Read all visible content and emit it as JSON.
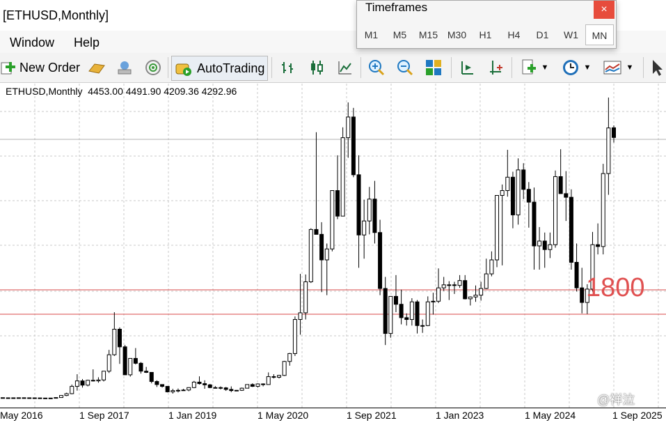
{
  "window": {
    "title": "[ETHUSD,Monthly]"
  },
  "menu": {
    "items": [
      "Window",
      "Help"
    ]
  },
  "toolbar": {
    "new_order": "New Order",
    "autotrading": "AutoTrading"
  },
  "timeframes_popup": {
    "title": "Timeframes",
    "close": "×",
    "items": [
      "M1",
      "M5",
      "M15",
      "M30",
      "H1",
      "H4",
      "D1",
      "W1",
      "MN"
    ],
    "active": "MN"
  },
  "chart": {
    "symbol": "ETHUSD,Monthly",
    "ohlc": "4453.00 4491.90 4209.36 4292.96",
    "level_label": "1800",
    "x_ticks": [
      "May 2016",
      "1 Sep 2017",
      "1 Jan 2019",
      "1 May 2020",
      "1 Sep 2021",
      "1 Jan 2023",
      "1 May 2024",
      "1 Sep 2025"
    ],
    "level_color": "#d94a4a",
    "up_color": "#ffffff",
    "down_color": "#000000"
  },
  "watermark": "@祥泣",
  "chart_data": {
    "type": "candlestick",
    "x_ticks": [
      "May 2016",
      "1 Sep 2017",
      "1 Jan 2019",
      "1 May 2020",
      "1 Sep 2021",
      "1 Jan 2023",
      "1 May 2024",
      "1 Sep 2025"
    ],
    "horizontal_levels": [
      1800
    ],
    "last_ohlc": {
      "open": 4453.0,
      "high": 4491.9,
      "low": 4209.36,
      "close": 4292.96
    },
    "candles": [
      {
        "o": 14,
        "h": 14,
        "l": 12,
        "c": 12
      },
      {
        "o": 12,
        "h": 13,
        "l": 11,
        "c": 11
      },
      {
        "o": 11,
        "h": 12,
        "l": 10,
        "c": 12
      },
      {
        "o": 12,
        "h": 13,
        "l": 11,
        "c": 13
      },
      {
        "o": 13,
        "h": 14,
        "l": 12,
        "c": 12
      },
      {
        "o": 12,
        "h": 13,
        "l": 10,
        "c": 11
      },
      {
        "o": 11,
        "h": 12,
        "l": 9,
        "c": 10
      },
      {
        "o": 10,
        "h": 10,
        "l": 7,
        "c": 8
      },
      {
        "o": 8,
        "h": 10,
        "l": 7,
        "c": 8
      },
      {
        "o": 8,
        "h": 9,
        "l": 8,
        "c": 8
      },
      {
        "o": 8,
        "h": 17,
        "l": 8,
        "c": 16
      },
      {
        "o": 16,
        "h": 55,
        "l": 15,
        "c": 50
      },
      {
        "o": 50,
        "h": 95,
        "l": 40,
        "c": 80
      },
      {
        "o": 80,
        "h": 230,
        "l": 70,
        "c": 200
      },
      {
        "o": 200,
        "h": 400,
        "l": 130,
        "c": 290
      },
      {
        "o": 290,
        "h": 320,
        "l": 180,
        "c": 220
      },
      {
        "o": 220,
        "h": 310,
        "l": 200,
        "c": 300
      },
      {
        "o": 300,
        "h": 480,
        "l": 280,
        "c": 290
      },
      {
        "o": 290,
        "h": 350,
        "l": 260,
        "c": 305
      },
      {
        "o": 305,
        "h": 340,
        "l": 280,
        "c": 450
      },
      {
        "o": 450,
        "h": 800,
        "l": 420,
        "c": 720
      },
      {
        "o": 720,
        "h": 1420,
        "l": 700,
        "c": 1140
      },
      {
        "o": 1140,
        "h": 1170,
        "l": 570,
        "c": 850
      },
      {
        "o": 850,
        "h": 880,
        "l": 400,
        "c": 390
      },
      {
        "o": 390,
        "h": 420,
        "l": 360,
        "c": 660
      },
      {
        "o": 660,
        "h": 830,
        "l": 560,
        "c": 580
      },
      {
        "o": 580,
        "h": 600,
        "l": 410,
        "c": 450
      },
      {
        "o": 450,
        "h": 520,
        "l": 420,
        "c": 430
      },
      {
        "o": 430,
        "h": 430,
        "l": 250,
        "c": 280
      },
      {
        "o": 280,
        "h": 300,
        "l": 190,
        "c": 230
      },
      {
        "o": 230,
        "h": 230,
        "l": 180,
        "c": 200
      },
      {
        "o": 200,
        "h": 200,
        "l": 100,
        "c": 110
      },
      {
        "o": 110,
        "h": 160,
        "l": 80,
        "c": 130
      },
      {
        "o": 130,
        "h": 165,
        "l": 100,
        "c": 135
      },
      {
        "o": 135,
        "h": 160,
        "l": 130,
        "c": 140
      },
      {
        "o": 140,
        "h": 185,
        "l": 120,
        "c": 180
      },
      {
        "o": 180,
        "h": 290,
        "l": 170,
        "c": 270
      },
      {
        "o": 270,
        "h": 365,
        "l": 230,
        "c": 245
      },
      {
        "o": 245,
        "h": 300,
        "l": 160,
        "c": 225
      },
      {
        "o": 225,
        "h": 240,
        "l": 170,
        "c": 180
      },
      {
        "o": 180,
        "h": 205,
        "l": 165,
        "c": 180
      },
      {
        "o": 180,
        "h": 200,
        "l": 150,
        "c": 175
      },
      {
        "o": 175,
        "h": 190,
        "l": 125,
        "c": 150
      },
      {
        "o": 150,
        "h": 200,
        "l": 105,
        "c": 130
      },
      {
        "o": 130,
        "h": 140,
        "l": 120,
        "c": 135
      },
      {
        "o": 135,
        "h": 180,
        "l": 125,
        "c": 170
      },
      {
        "o": 170,
        "h": 230,
        "l": 175,
        "c": 230
      },
      {
        "o": 230,
        "h": 250,
        "l": 190,
        "c": 200
      },
      {
        "o": 200,
        "h": 250,
        "l": 180,
        "c": 240
      },
      {
        "o": 240,
        "h": 250,
        "l": 200,
        "c": 230
      },
      {
        "o": 230,
        "h": 430,
        "l": 230,
        "c": 360
      },
      {
        "o": 360,
        "h": 400,
        "l": 330,
        "c": 350
      },
      {
        "o": 350,
        "h": 390,
        "l": 330,
        "c": 380
      },
      {
        "o": 380,
        "h": 620,
        "l": 370,
        "c": 610
      },
      {
        "o": 610,
        "h": 750,
        "l": 540,
        "c": 740
      },
      {
        "o": 740,
        "h": 1350,
        "l": 700,
        "c": 1300
      },
      {
        "o": 1300,
        "h": 2050,
        "l": 1050,
        "c": 1410
      },
      {
        "o": 1410,
        "h": 2040,
        "l": 1300,
        "c": 1920
      },
      {
        "o": 1920,
        "h": 2800,
        "l": 1900,
        "c": 2780
      },
      {
        "o": 2780,
        "h": 4380,
        "l": 2700,
        "c": 2700
      },
      {
        "o": 2700,
        "h": 2900,
        "l": 1750,
        "c": 2280
      },
      {
        "o": 2280,
        "h": 2550,
        "l": 1700,
        "c": 2460
      },
      {
        "o": 2460,
        "h": 3400,
        "l": 2420,
        "c": 3420
      },
      {
        "o": 3420,
        "h": 4000,
        "l": 2950,
        "c": 3000
      },
      {
        "o": 3000,
        "h": 4460,
        "l": 3000,
        "c": 4290
      },
      {
        "o": 4290,
        "h": 4870,
        "l": 3960,
        "c": 4630
      },
      {
        "o": 4630,
        "h": 4780,
        "l": 3640,
        "c": 3680
      },
      {
        "o": 3680,
        "h": 4000,
        "l": 2150,
        "c": 2690
      },
      {
        "o": 2690,
        "h": 3270,
        "l": 2300,
        "c": 2920
      },
      {
        "o": 2920,
        "h": 3480,
        "l": 2700,
        "c": 3280
      },
      {
        "o": 3280,
        "h": 3580,
        "l": 2550,
        "c": 2730
      },
      {
        "o": 2730,
        "h": 2940,
        "l": 1700,
        "c": 1810
      },
      {
        "o": 1810,
        "h": 2000,
        "l": 880,
        "c": 1070
      },
      {
        "o": 1070,
        "h": 1280,
        "l": 1000,
        "c": 1680
      },
      {
        "o": 1680,
        "h": 2030,
        "l": 1420,
        "c": 1550
      },
      {
        "o": 1550,
        "h": 1790,
        "l": 1220,
        "c": 1330
      },
      {
        "o": 1330,
        "h": 1400,
        "l": 1200,
        "c": 1300
      },
      {
        "o": 1300,
        "h": 1650,
        "l": 1200,
        "c": 1590
      },
      {
        "o": 1590,
        "h": 1620,
        "l": 1070,
        "c": 1200
      },
      {
        "o": 1200,
        "h": 1300,
        "l": 1080,
        "c": 1200
      },
      {
        "o": 1200,
        "h": 1680,
        "l": 1190,
        "c": 1590
      },
      {
        "o": 1590,
        "h": 1740,
        "l": 1380,
        "c": 1600
      },
      {
        "o": 1600,
        "h": 2140,
        "l": 1570,
        "c": 1820
      },
      {
        "o": 1820,
        "h": 2000,
        "l": 1770,
        "c": 1870
      },
      {
        "o": 1870,
        "h": 1930,
        "l": 1620,
        "c": 1870
      },
      {
        "o": 1870,
        "h": 1920,
        "l": 1720,
        "c": 1860
      },
      {
        "o": 1860,
        "h": 2030,
        "l": 1820,
        "c": 1940
      },
      {
        "o": 1940,
        "h": 2030,
        "l": 1630,
        "c": 1640
      },
      {
        "o": 1640,
        "h": 1680,
        "l": 1530,
        "c": 1670
      },
      {
        "o": 1670,
        "h": 1860,
        "l": 1590,
        "c": 1700
      },
      {
        "o": 1700,
        "h": 1920,
        "l": 1610,
        "c": 1810
      },
      {
        "o": 1810,
        "h": 2300,
        "l": 1800,
        "c": 2050
      },
      {
        "o": 2050,
        "h": 2420,
        "l": 2010,
        "c": 2280
      },
      {
        "o": 2280,
        "h": 2720,
        "l": 2160,
        "c": 3340
      },
      {
        "o": 3340,
        "h": 3520,
        "l": 2190,
        "c": 3420
      },
      {
        "o": 3420,
        "h": 4090,
        "l": 3320,
        "c": 3640
      },
      {
        "o": 3640,
        "h": 3730,
        "l": 2800,
        "c": 3020
      },
      {
        "o": 3020,
        "h": 3950,
        "l": 2860,
        "c": 3760
      },
      {
        "o": 3760,
        "h": 3870,
        "l": 3280,
        "c": 3440
      },
      {
        "o": 3440,
        "h": 3560,
        "l": 2810,
        "c": 3230
      },
      {
        "o": 3230,
        "h": 3470,
        "l": 2120,
        "c": 2510
      },
      {
        "o": 2510,
        "h": 2820,
        "l": 2120,
        "c": 2590
      },
      {
        "o": 2590,
        "h": 2730,
        "l": 2150,
        "c": 2450
      },
      {
        "o": 2450,
        "h": 2730,
        "l": 2310,
        "c": 2530
      },
      {
        "o": 2530,
        "h": 3750,
        "l": 2480,
        "c": 3650
      },
      {
        "o": 3650,
        "h": 4100,
        "l": 3530,
        "c": 3370
      },
      {
        "o": 3370,
        "h": 3740,
        "l": 2920,
        "c": 3310
      },
      {
        "o": 3310,
        "h": 3440,
        "l": 2120,
        "c": 2240
      },
      {
        "o": 2240,
        "h": 2550,
        "l": 1760,
        "c": 1820
      },
      {
        "o": 1820,
        "h": 2150,
        "l": 1400,
        "c": 1580
      },
      {
        "o": 1580,
        "h": 1880,
        "l": 1390,
        "c": 1800
      },
      {
        "o": 1800,
        "h": 2740,
        "l": 1760,
        "c": 2530
      },
      {
        "o": 2530,
        "h": 2880,
        "l": 2370,
        "c": 2500
      },
      {
        "o": 2500,
        "h": 3860,
        "l": 2370,
        "c": 3700
      },
      {
        "o": 3700,
        "h": 4950,
        "l": 3350,
        "c": 4450
      },
      {
        "o": 4453.0,
        "h": 4491.9,
        "l": 4209.36,
        "c": 4292.96
      }
    ]
  }
}
